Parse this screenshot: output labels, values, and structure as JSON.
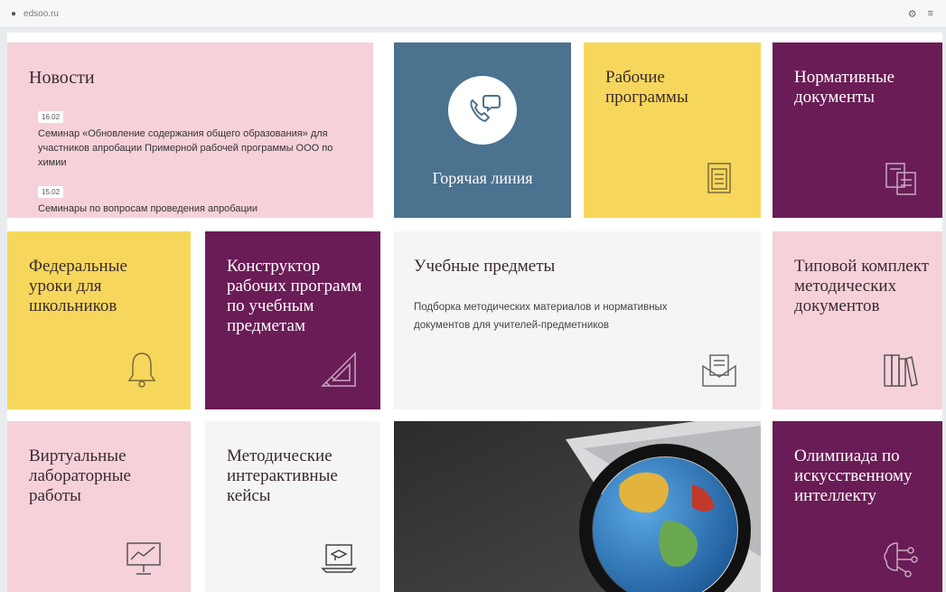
{
  "browser": {
    "url": "edsoo.ru"
  },
  "news": {
    "title": "Новости",
    "items": [
      {
        "date": "16.02",
        "text": "Семинар «Обновление содержания общего образования» для участников апробации Примерной рабочей программы ООО по химии"
      },
      {
        "date": "15.02",
        "text": "Семинары по вопросам проведения апробации"
      }
    ]
  },
  "tiles": {
    "hotline": "Горячая линия",
    "work_programs": "Рабочие программы",
    "normative_docs": "Нормативные документы",
    "federal_lessons": "Федеральные уроки для школьников",
    "constructor": "Конструктор рабочих программ по учебным предметам",
    "subjects_title": "Учебные предметы",
    "subjects_desc": "Подборка методических материалов и нормативных документов для учителей-предметников",
    "typical_set": "Типовой комплект методических документов",
    "virtual_labs": "Виртуальные лабораторные работы",
    "method_cases": "Методические интерактивные кейсы",
    "olympiad": "Олимпиада по искусственному интеллекту"
  },
  "icons": {
    "hotline": "phone-chat-icon",
    "work_programs": "document-icon",
    "normative_docs": "documents-icon",
    "federal_lessons": "bell-icon",
    "constructor": "ruler-triangle-icon",
    "subjects": "envelope-document-icon",
    "typical_set": "books-icon",
    "virtual_labs": "presentation-chart-icon",
    "method_cases": "laptop-graduation-icon",
    "olympiad": "ai-brain-icon"
  },
  "colors": {
    "pink": "#f6d1d9",
    "yellow": "#f6d75c",
    "purple": "#6a1c56",
    "slate": "#4b728f"
  }
}
